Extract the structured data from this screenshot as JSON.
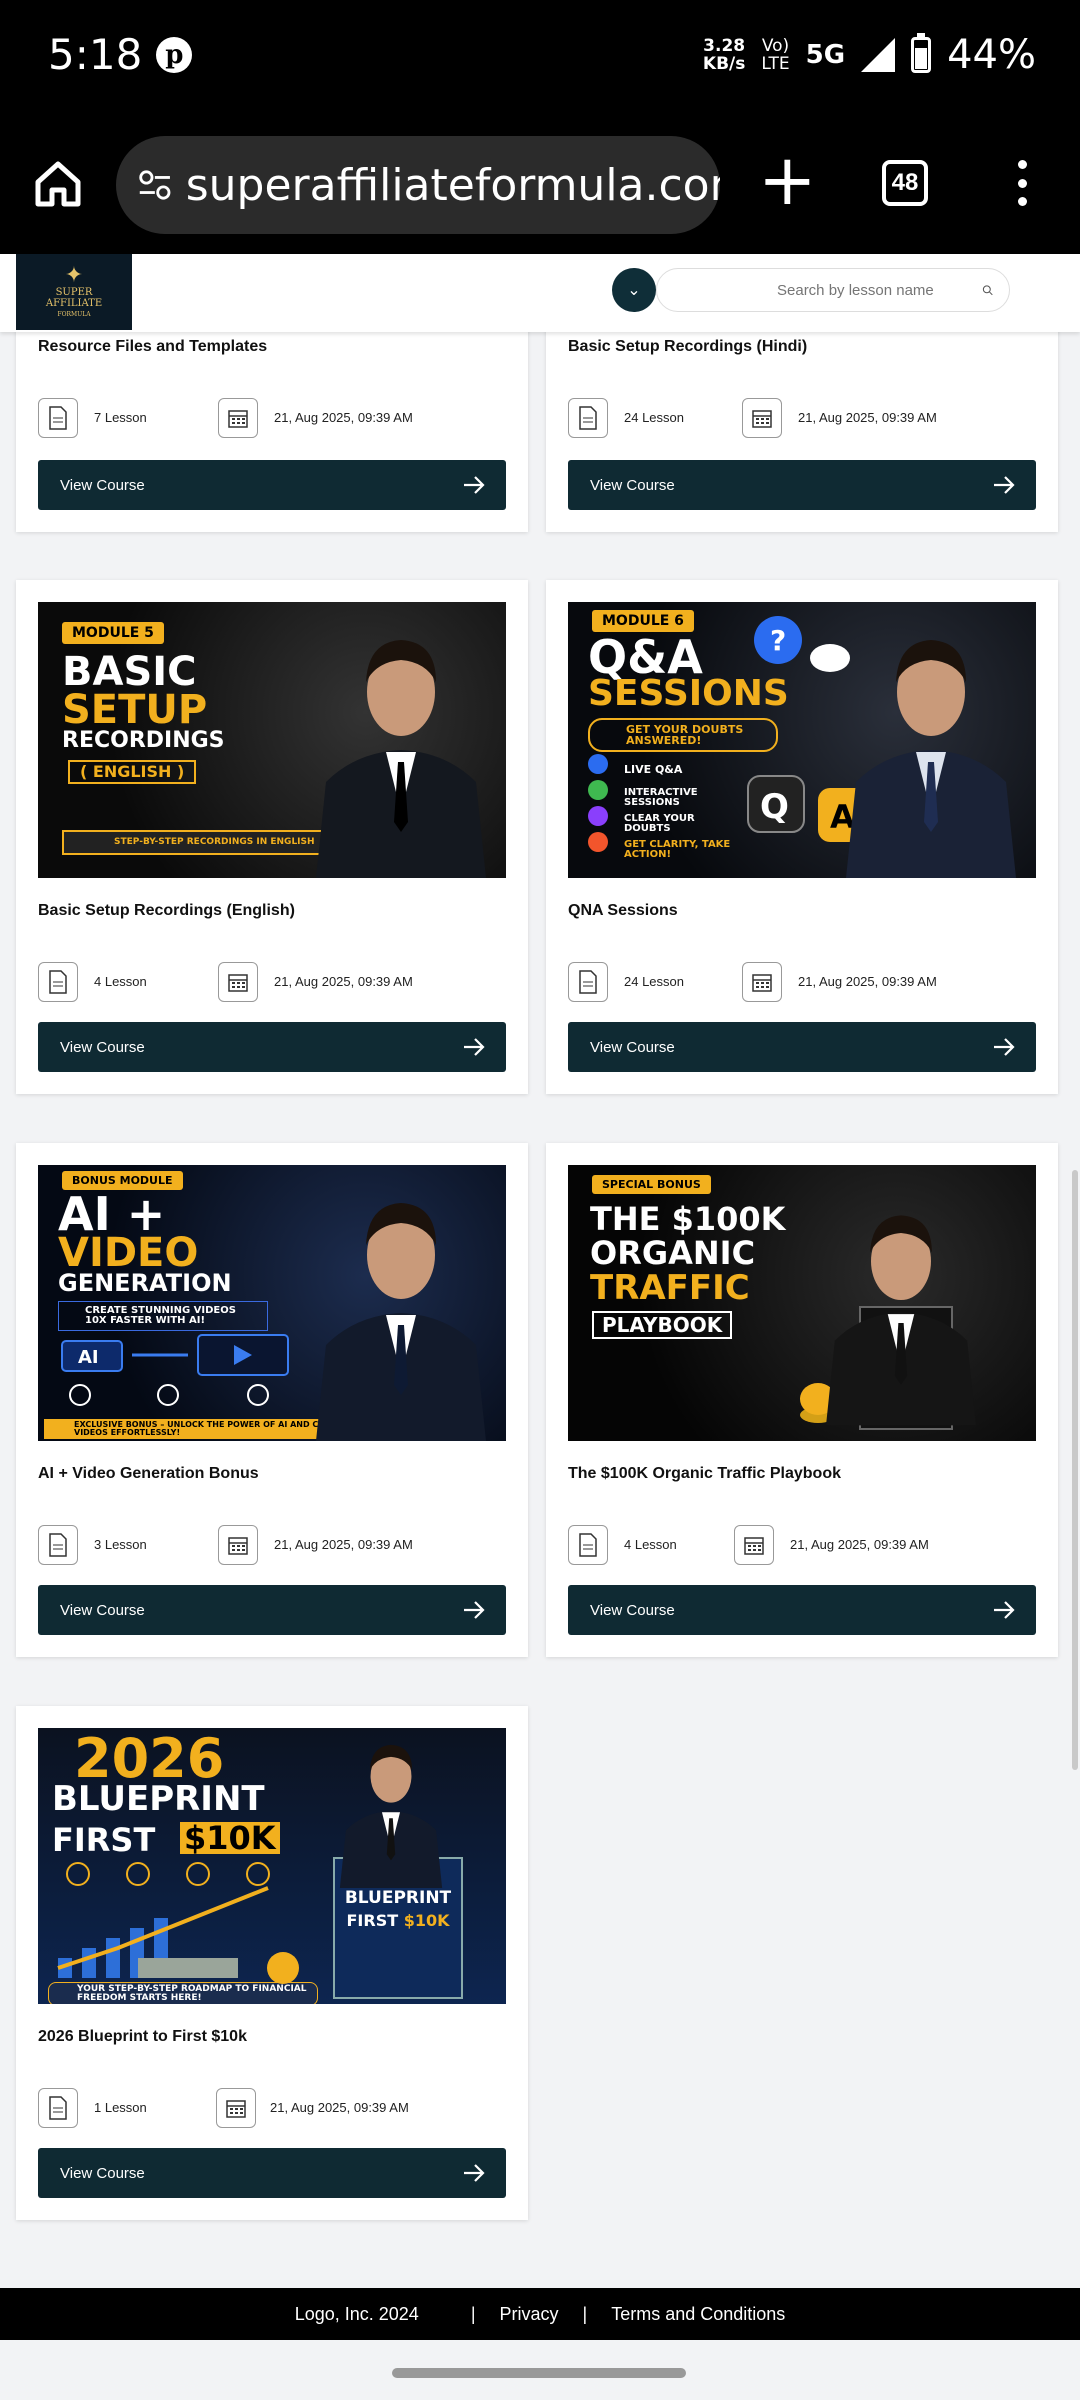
{
  "status_bar": {
    "time": "5:18",
    "speed_value": "3.28",
    "speed_unit": "KB/s",
    "volte_top": "Vo)",
    "volte_bottom": "LTE",
    "network": "5G",
    "battery": "44%"
  },
  "browser": {
    "url": "superaffiliateformula.com",
    "tab_count": "48"
  },
  "header": {
    "logo_line1": "SUPER",
    "logo_line2": "AFFILIATE",
    "logo_line3": "FORMULA",
    "search_placeholder": "Search by lesson name"
  },
  "cards": [
    {
      "title": "Resource Files and Templates",
      "lessons": "7 Lesson",
      "date": "21, Aug 2025, 09:39 AM",
      "button": "View Course"
    },
    {
      "title": "Basic Setup Recordings (Hindi)",
      "lessons": "24 Lesson",
      "date": "21, Aug 2025, 09:39 AM",
      "button": "View Course"
    },
    {
      "title": "Basic Setup Recordings (English)",
      "lessons": "4 Lesson",
      "date": "21, Aug 2025, 09:39 AM",
      "button": "View Course",
      "thumb": {
        "tag": "MODULE 5",
        "line1": "BASIC",
        "line2": "SETUP",
        "line3": "RECORDINGS",
        "line4": "( ENGLISH )",
        "footer": "STEP-BY-STEP RECORDINGS IN ENGLISH"
      }
    },
    {
      "title": "QNA Sessions",
      "lessons": "24 Lesson",
      "date": "21, Aug 2025, 09:39 AM",
      "button": "View Course",
      "thumb": {
        "tag": "MODULE 6",
        "line1": "Q&A",
        "line2": "SESSIONS",
        "line3": "GET YOUR DOUBTS ANSWERED!",
        "b1": "LIVE Q&A",
        "b2": "INTERACTIVE SESSIONS",
        "b3": "CLEAR YOUR DOUBTS",
        "b4": "GET CLARITY, TAKE ACTION!"
      }
    },
    {
      "title": "AI + Video Generation Bonus",
      "lessons": "3 Lesson",
      "date": "21, Aug 2025, 09:39 AM",
      "button": "View Course",
      "thumb": {
        "tag": "BONUS MODULE",
        "line1": "AI +",
        "line2": "VIDEO",
        "line3": "GENERATION",
        "line4": "CREATE STUNNING VIDEOS 10X FASTER WITH AI!",
        "footer": "EXCLUSIVE BONUS – UNLOCK THE POWER OF AI AND CREATE PROFESSIONAL VIDEOS EFFORTLESSLY!"
      }
    },
    {
      "title": "The $100K Organic Traffic Playbook",
      "lessons": "4 Lesson",
      "date": "21, Aug 2025, 09:39 AM",
      "button": "View Course",
      "thumb": {
        "tag": "SPECIAL BONUS",
        "line1": "THE $100K",
        "line2": "ORGANIC",
        "line3": "TRAFFIC",
        "line4": "PLAYBOOK"
      }
    },
    {
      "title": "2026 Blueprint to First $10k",
      "lessons": "1 Lesson",
      "date": "21, Aug 2025, 09:39 AM",
      "button": "View Course",
      "thumb": {
        "line1": "2026",
        "line2": "BLUEPRINT",
        "line3": "FIRST",
        "line4": "$10K",
        "footer": "YOUR STEP-BY-STEP ROADMAP TO FINANCIAL FREEDOM STARTS HERE!"
      }
    }
  ],
  "footer": {
    "copyright": "Logo, Inc. 2024",
    "sep": "|",
    "privacy": "Privacy",
    "terms": "Terms and Conditions"
  }
}
